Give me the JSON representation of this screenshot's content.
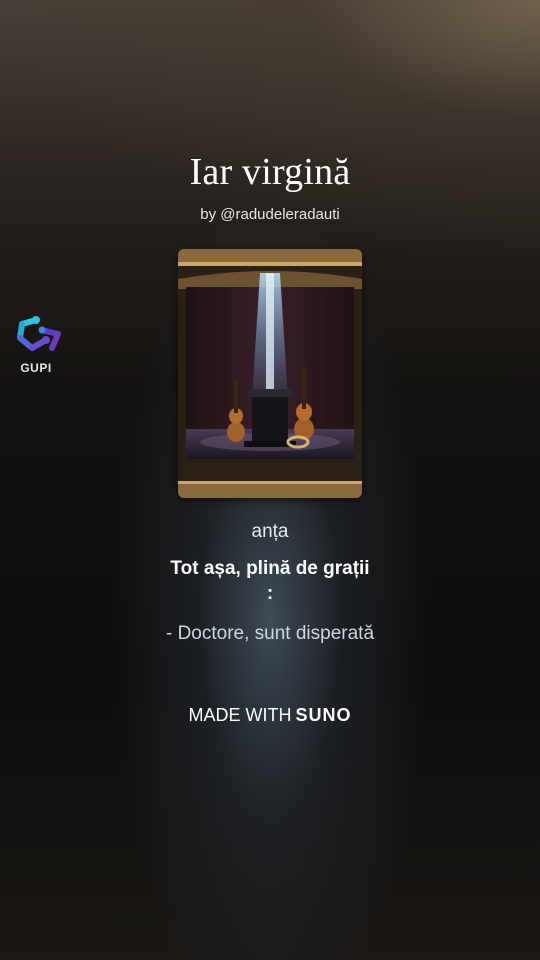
{
  "song": {
    "title": "Iar virgină",
    "byline": "by @radudeleradauti"
  },
  "watermark": {
    "label": "GUPI",
    "icon": "gupi-logo-icon"
  },
  "lyrics": {
    "previous": "anța",
    "current": "Tot așa, plină de grații",
    "current_suffix": ":",
    "next": "- Doctore, sunt disperată"
  },
  "footer": {
    "made_with": "MADE WITH",
    "brand": "SUNO"
  },
  "cover": {
    "icon": "violin-stage-artwork",
    "colors": {
      "frame": "#9a7a4a",
      "curtain": "#3a1f28",
      "light": "#7fc0ff"
    }
  }
}
